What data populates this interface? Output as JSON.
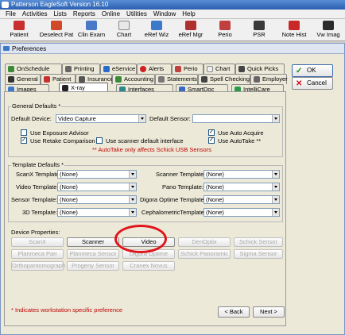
{
  "app": {
    "title": "Patterson EagleSoft Version 16.10"
  },
  "menu": [
    "File",
    "Activities",
    "Lists",
    "Reports",
    "Online",
    "Utilities",
    "Window",
    "Help"
  ],
  "toolbar": [
    "Patient",
    "Deselect Pat",
    "Clin Exam",
    "Chart",
    "eRef Wiz",
    "eRef Mgr",
    "Perio",
    "PSR",
    "Note Hist",
    "Vw Imag"
  ],
  "window": {
    "title": "Preferences"
  },
  "tabs": {
    "row1": [
      "OnSchedule",
      "Printing",
      "eService",
      "Alerts",
      "Perio",
      "Chart",
      "Quick Picks"
    ],
    "row2": [
      "General",
      "Patient",
      "Insurance",
      "Accounting",
      "Statements",
      "Spell Checking",
      "Employer"
    ],
    "row3": [
      "Images",
      "X-ray",
      "Interfaces",
      "SmartDoc",
      "IntelliCare"
    ]
  },
  "buttons": {
    "ok": "OK",
    "cancel": "Cancel",
    "back": "< Back",
    "next": "Next >"
  },
  "general": {
    "title": "General Defaults *",
    "device_label": "Default Device:",
    "device_value": "Video Capture",
    "sensor_label": "Default Sensor:",
    "sensor_value": "",
    "checks": {
      "exposure": "Use Exposure Advisor",
      "retake": "Use Retake Comparison",
      "scanner_iface": "Use scanner default interface",
      "autoacquire": "Use Auto Acquire",
      "autotake": "Use AutoTake **"
    },
    "note": "** AutoTake only affects Schick USB Sensors"
  },
  "templates": {
    "title": "Template Defaults *",
    "items": [
      {
        "label": "ScanX Template:",
        "value": "(None)"
      },
      {
        "label": "Scanner Template:",
        "value": "(None)"
      },
      {
        "label": "Video Template:",
        "value": "(None)"
      },
      {
        "label": "Pano Template:",
        "value": "(None)"
      },
      {
        "label": "Sensor Template:",
        "value": "(None)"
      },
      {
        "label": "Digora Optime Template:",
        "value": "(None)"
      },
      {
        "label": "3D Template:",
        "value": "(None)"
      },
      {
        "label": "CephalometricTemplate:",
        "value": "(None)"
      }
    ]
  },
  "device_props": {
    "title": "Device Properties:",
    "row1": [
      "ScanX",
      "Scanner",
      "Video",
      "DenOptix",
      "Schick Sensor"
    ],
    "row2": [
      "Planmeca Pan",
      "Planmeca Sensor",
      "Digora Optime",
      "Schick Panoramic",
      "Sigma Sensor"
    ],
    "row3": [
      "Orthopantomograph",
      "Progeny Sensor",
      "Cranex Novus"
    ]
  },
  "footer_note": "* Indicates workstation specific preference"
}
